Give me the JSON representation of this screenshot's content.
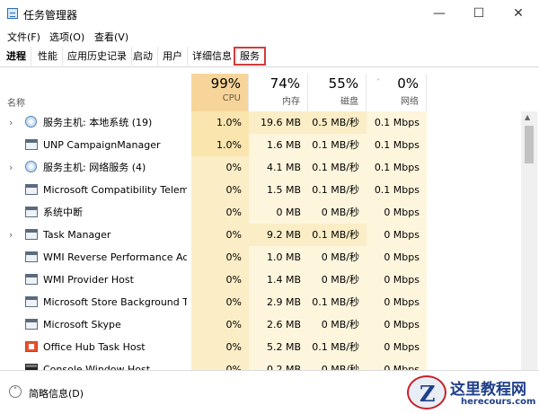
{
  "window": {
    "title": "任务管理器",
    "min_glyph": "—",
    "max_glyph": "☐",
    "close_glyph": "✕"
  },
  "menu": [
    "文件(F)",
    "选项(O)",
    "查看(V)"
  ],
  "tabs": [
    "进程",
    "性能",
    "应用历史记录",
    "启动",
    "用户",
    "详细信息",
    "服务"
  ],
  "active_tab": "进程",
  "highlighted_tab": "服务",
  "columns": {
    "name": "名称",
    "cpu": {
      "pct": "99%",
      "label": "CPU"
    },
    "mem": {
      "pct": "74%",
      "label": "内存"
    },
    "disk": {
      "pct": "55%",
      "label": "磁盘"
    },
    "net": {
      "pct": "0%",
      "label": "网络"
    }
  },
  "processes": [
    {
      "name": "服务主机: 本地系统 (19)",
      "cpu": "1.0%",
      "mem": "19.6 MB",
      "disk": "0.5 MB/秒",
      "net": "0.1 Mbps",
      "expandable": true,
      "icon": "gear-icon"
    },
    {
      "name": "UNP CampaignManager",
      "cpu": "1.0%",
      "mem": "1.6 MB",
      "disk": "0.1 MB/秒",
      "net": "0.1 Mbps",
      "expandable": false,
      "icon": "window-icon"
    },
    {
      "name": "服务主机: 网络服务 (4)",
      "cpu": "0%",
      "mem": "4.1 MB",
      "disk": "0.1 MB/秒",
      "net": "0.1 Mbps",
      "expandable": true,
      "icon": "gear-icon"
    },
    {
      "name": "Microsoft Compatibility Telemetry",
      "cpu": "0%",
      "mem": "1.5 MB",
      "disk": "0.1 MB/秒",
      "net": "0.1 Mbps",
      "expandable": false,
      "icon": "window-icon"
    },
    {
      "name": "系统中断",
      "cpu": "0%",
      "mem": "0 MB",
      "disk": "0 MB/秒",
      "net": "0 Mbps",
      "expandable": false,
      "icon": "window-icon"
    },
    {
      "name": "Task Manager",
      "cpu": "0%",
      "mem": "9.2 MB",
      "disk": "0.1 MB/秒",
      "net": "0 Mbps",
      "expandable": true,
      "icon": "window-icon"
    },
    {
      "name": "WMI Reverse Performance Adapter",
      "cpu": "0%",
      "mem": "1.0 MB",
      "disk": "0 MB/秒",
      "net": "0 Mbps",
      "expandable": false,
      "icon": "window-icon"
    },
    {
      "name": "WMI Provider Host",
      "cpu": "0%",
      "mem": "1.4 MB",
      "disk": "0 MB/秒",
      "net": "0 Mbps",
      "expandable": false,
      "icon": "window-icon"
    },
    {
      "name": "Microsoft Store Background Task Host",
      "cpu": "0%",
      "mem": "2.9 MB",
      "disk": "0.1 MB/秒",
      "net": "0 Mbps",
      "expandable": false,
      "icon": "window-icon"
    },
    {
      "name": "Microsoft Skype",
      "cpu": "0%",
      "mem": "2.6 MB",
      "disk": "0 MB/秒",
      "net": "0 Mbps",
      "expandable": false,
      "icon": "window-icon"
    },
    {
      "name": "Office Hub Task Host",
      "cpu": "0%",
      "mem": "5.2 MB",
      "disk": "0.1 MB/秒",
      "net": "0 Mbps",
      "expandable": false,
      "icon": "office-icon"
    },
    {
      "name": "Console Window Host",
      "cpu": "0%",
      "mem": "0.2 MB",
      "disk": "0 MB/秒",
      "net": "0 Mbps",
      "expandable": false,
      "icon": "console-icon"
    }
  ],
  "footer": {
    "fewer_details": "简略信息(D)"
  },
  "watermark": {
    "text": "这里教程网",
    "url": "herecours.com"
  },
  "colors": {
    "accent_red": "#d43b3b",
    "heat_strong": "#f9e5ad",
    "heat_light": "#fdf5dc",
    "sorted_header": "#f7d59a"
  }
}
